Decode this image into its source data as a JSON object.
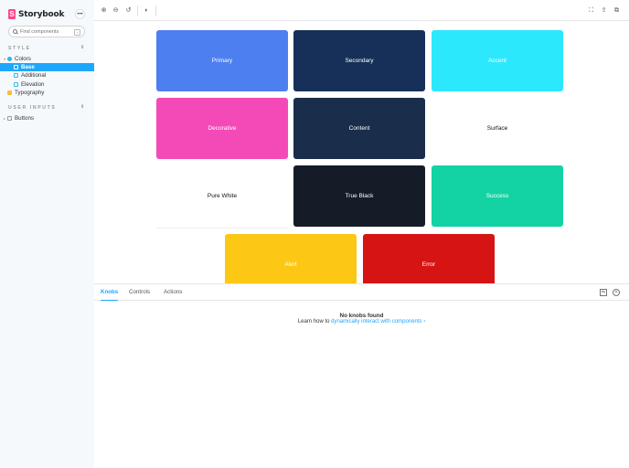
{
  "sidebar": {
    "brand": "Storybook",
    "brand_logo_letter": "S",
    "menu_label": "•••",
    "search": {
      "placeholder": "Find components",
      "shortcut": "/"
    },
    "sections": [
      {
        "title": "STYLE",
        "toggle": "⇕"
      },
      {
        "title": "USER INPUTS",
        "toggle": "⇕"
      }
    ],
    "items": [
      {
        "label": "Colors"
      },
      {
        "label": "Base"
      },
      {
        "label": "Additional"
      },
      {
        "label": "Elevation"
      },
      {
        "label": "Typography"
      },
      {
        "label": "Buttons"
      }
    ]
  },
  "toolbar": {
    "zoom_in": "⊕",
    "zoom_out": "⊖",
    "zoom_reset": "↺",
    "background": "◐",
    "fullscreen": "⛶",
    "share": "⇪",
    "copy": "⧉"
  },
  "swatches": [
    {
      "label": "Primary",
      "bg": "#4d7ff0",
      "fg": "#ffffff"
    },
    {
      "label": "Secondary",
      "bg": "#17305a",
      "fg": "#ffffff"
    },
    {
      "label": "Accent",
      "bg": "#2ce8fd",
      "fg": "#ffffff"
    },
    {
      "label": "Decorative",
      "bg": "#f44ab8",
      "fg": "#ffffff"
    },
    {
      "label": "Content",
      "bg": "#1a2e4c",
      "fg": "#ffffff"
    },
    {
      "label": "Surface",
      "bg": "#ffffff",
      "fg": "#111111"
    },
    {
      "label": "Pure White",
      "bg": "#ffffff",
      "fg": "#111111"
    },
    {
      "label": "True Black",
      "bg": "#151c28",
      "fg": "#ffffff"
    },
    {
      "label": "Success",
      "bg": "#13d3a4",
      "fg": "#ffffff"
    },
    {
      "label": "Alert",
      "bg": "#fdc815",
      "fg": "#ffffff"
    },
    {
      "label": "Error",
      "bg": "#d61414",
      "fg": "#ffffff"
    }
  ],
  "panel": {
    "tabs": [
      "Knobs",
      "Controls",
      "Actions"
    ],
    "empty_title": "No knobs found",
    "empty_prefix": "Learn how to",
    "empty_link": "dynamically interact with components",
    "empty_suffix": "›"
  }
}
